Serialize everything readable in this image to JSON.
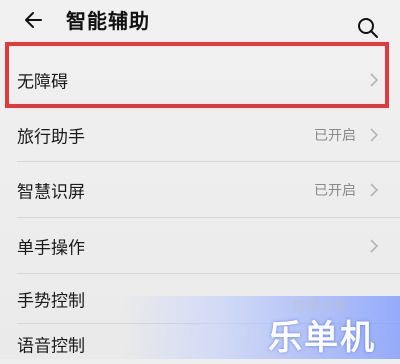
{
  "header": {
    "title": "智能辅助",
    "back_icon": "back-arrow-icon",
    "search_icon": "search-icon"
  },
  "list": {
    "items": [
      {
        "label": "无障碍",
        "status": "",
        "highlighted": true
      },
      {
        "label": "旅行助手",
        "status": "已开启",
        "highlighted": false
      },
      {
        "label": "智慧识屏",
        "status": "已开启",
        "highlighted": false
      },
      {
        "label": "单手操作",
        "status": "",
        "highlighted": false
      },
      {
        "label": "手势控制",
        "status": "",
        "highlighted": false
      },
      {
        "label": "语音控制",
        "status": "",
        "highlighted": false
      }
    ]
  },
  "overlay": {
    "faded_text": "智慧识屏",
    "watermark": "乐单机",
    "highlight_color": "#e0393e"
  }
}
